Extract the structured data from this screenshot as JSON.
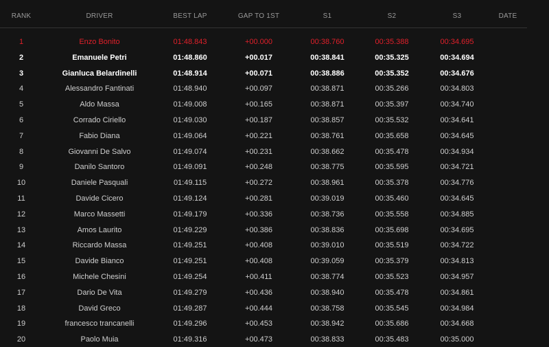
{
  "header": {
    "rank": "RANK",
    "driver": "DRIVER",
    "best_lap": "BEST LAP",
    "gap": "GAP TO 1ST",
    "s1": "S1",
    "s2": "S2",
    "s3": "S3",
    "date": "DATE"
  },
  "colors": {
    "background": "#141414",
    "leader": "#e0202a",
    "top3": "#ffffff",
    "text": "#cfcfcf",
    "header_text": "#9a9a9a"
  },
  "rows": [
    {
      "rank": "1",
      "driver": "Enzo Bonito",
      "best": "01:48.843",
      "gap": "+00.000",
      "s1": "00:38.760",
      "s2": "00:35.388",
      "s3": "00:34.695",
      "date": ""
    },
    {
      "rank": "2",
      "driver": "Emanuele Petri",
      "best": "01:48.860",
      "gap": "+00.017",
      "s1": "00:38.841",
      "s2": "00:35.325",
      "s3": "00:34.694",
      "date": ""
    },
    {
      "rank": "3",
      "driver": "Gianluca Belardinelli",
      "best": "01:48.914",
      "gap": "+00.071",
      "s1": "00:38.886",
      "s2": "00:35.352",
      "s3": "00:34.676",
      "date": ""
    },
    {
      "rank": "4",
      "driver": "Alessandro Fantinati",
      "best": "01:48.940",
      "gap": "+00.097",
      "s1": "00:38.871",
      "s2": "00:35.266",
      "s3": "00:34.803",
      "date": ""
    },
    {
      "rank": "5",
      "driver": "Aldo Massa",
      "best": "01:49.008",
      "gap": "+00.165",
      "s1": "00:38.871",
      "s2": "00:35.397",
      "s3": "00:34.740",
      "date": ""
    },
    {
      "rank": "6",
      "driver": "Corrado Ciriello",
      "best": "01:49.030",
      "gap": "+00.187",
      "s1": "00:38.857",
      "s2": "00:35.532",
      "s3": "00:34.641",
      "date": ""
    },
    {
      "rank": "7",
      "driver": "Fabio Diana",
      "best": "01:49.064",
      "gap": "+00.221",
      "s1": "00:38.761",
      "s2": "00:35.658",
      "s3": "00:34.645",
      "date": ""
    },
    {
      "rank": "8",
      "driver": "Giovanni De Salvo",
      "best": "01:49.074",
      "gap": "+00.231",
      "s1": "00:38.662",
      "s2": "00:35.478",
      "s3": "00:34.934",
      "date": ""
    },
    {
      "rank": "9",
      "driver": "Danilo Santoro",
      "best": "01:49.091",
      "gap": "+00.248",
      "s1": "00:38.775",
      "s2": "00:35.595",
      "s3": "00:34.721",
      "date": ""
    },
    {
      "rank": "10",
      "driver": "Daniele Pasquali",
      "best": "01:49.115",
      "gap": "+00.272",
      "s1": "00:38.961",
      "s2": "00:35.378",
      "s3": "00:34.776",
      "date": ""
    },
    {
      "rank": "11",
      "driver": "Davide Cicero",
      "best": "01:49.124",
      "gap": "+00.281",
      "s1": "00:39.019",
      "s2": "00:35.460",
      "s3": "00:34.645",
      "date": ""
    },
    {
      "rank": "12",
      "driver": "Marco Massetti",
      "best": "01:49.179",
      "gap": "+00.336",
      "s1": "00:38.736",
      "s2": "00:35.558",
      "s3": "00:34.885",
      "date": ""
    },
    {
      "rank": "13",
      "driver": "Amos Laurito",
      "best": "01:49.229",
      "gap": "+00.386",
      "s1": "00:38.836",
      "s2": "00:35.698",
      "s3": "00:34.695",
      "date": ""
    },
    {
      "rank": "14",
      "driver": "Riccardo Massa",
      "best": "01:49.251",
      "gap": "+00.408",
      "s1": "00:39.010",
      "s2": "00:35.519",
      "s3": "00:34.722",
      "date": ""
    },
    {
      "rank": "15",
      "driver": "Davide Bianco",
      "best": "01:49.251",
      "gap": "+00.408",
      "s1": "00:39.059",
      "s2": "00:35.379",
      "s3": "00:34.813",
      "date": ""
    },
    {
      "rank": "16",
      "driver": "Michele Chesini",
      "best": "01:49.254",
      "gap": "+00.411",
      "s1": "00:38.774",
      "s2": "00:35.523",
      "s3": "00:34.957",
      "date": ""
    },
    {
      "rank": "17",
      "driver": "Dario De Vita",
      "best": "01:49.279",
      "gap": "+00.436",
      "s1": "00:38.940",
      "s2": "00:35.478",
      "s3": "00:34.861",
      "date": ""
    },
    {
      "rank": "18",
      "driver": "David Greco",
      "best": "01:49.287",
      "gap": "+00.444",
      "s1": "00:38.758",
      "s2": "00:35.545",
      "s3": "00:34.984",
      "date": ""
    },
    {
      "rank": "19",
      "driver": "francesco trancanelli",
      "best": "01:49.296",
      "gap": "+00.453",
      "s1": "00:38.942",
      "s2": "00:35.686",
      "s3": "00:34.668",
      "date": ""
    },
    {
      "rank": "20",
      "driver": "Paolo Muia",
      "best": "01:49.316",
      "gap": "+00.473",
      "s1": "00:38.833",
      "s2": "00:35.483",
      "s3": "00:35.000",
      "date": ""
    }
  ]
}
